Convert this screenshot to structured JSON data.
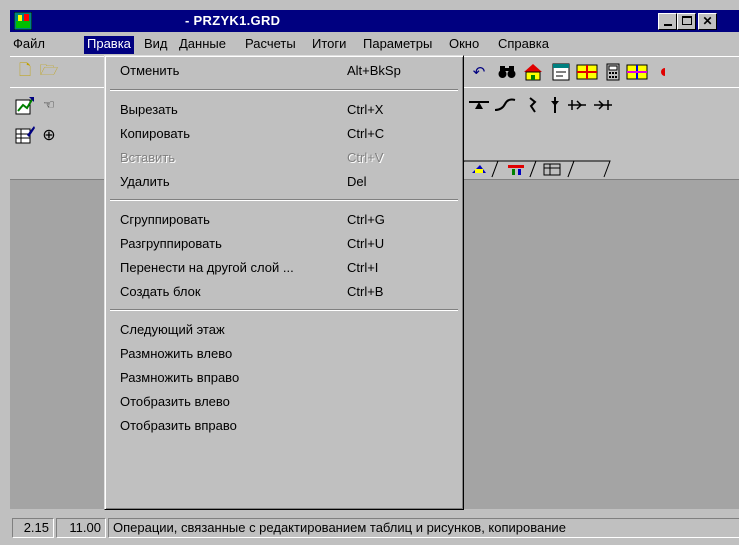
{
  "window": {
    "title": "- PRZYK1.GRD"
  },
  "menubar": {
    "items": [
      {
        "label": "Файл",
        "active": false
      },
      {
        "label": "Правка",
        "active": true
      },
      {
        "label": "Вид",
        "active": false
      },
      {
        "label": "Данные",
        "active": false
      },
      {
        "label": "Расчеты",
        "active": false
      },
      {
        "label": "Итоги",
        "active": false
      },
      {
        "label": "Параметры",
        "active": false
      },
      {
        "label": "Окно",
        "active": false
      },
      {
        "label": "Справка",
        "active": false
      }
    ]
  },
  "edit_menu": {
    "items": [
      {
        "label": "Отменить",
        "shortcut": "Alt+BkSp",
        "disabled": false
      },
      {
        "label": "Вырезать",
        "shortcut": "Ctrl+X",
        "disabled": false
      },
      {
        "label": "Копировать",
        "shortcut": "Ctrl+C",
        "disabled": false
      },
      {
        "label": "Вставить",
        "shortcut": "Ctrl+V",
        "disabled": true
      },
      {
        "label": "Удалить",
        "shortcut": "Del",
        "disabled": false
      },
      {
        "label": "Сгруппировать",
        "shortcut": "Ctrl+G",
        "disabled": false
      },
      {
        "label": "Разгруппировать",
        "shortcut": "Ctrl+U",
        "disabled": false
      },
      {
        "label": "Перенести на другой слой ...",
        "shortcut": "Ctrl+I",
        "disabled": false
      },
      {
        "label": "Создать блок",
        "shortcut": "Ctrl+B",
        "disabled": false
      },
      {
        "label": "Следующий этаж",
        "shortcut": "",
        "disabled": false
      },
      {
        "label": "Размножить влево",
        "shortcut": "",
        "disabled": false
      },
      {
        "label": "Размножить вправо",
        "shortcut": "",
        "disabled": false
      },
      {
        "label": "Отобразить влево",
        "shortcut": "",
        "disabled": false
      },
      {
        "label": "Отобразить вправо",
        "shortcut": "",
        "disabled": false
      }
    ]
  },
  "statusbar": {
    "coord_x": "2.15",
    "coord_y": "11.00",
    "message": "Операции, связанные с редактированием таблиц  и рисунков, копирование"
  },
  "colors": {
    "titlebar": "#000080",
    "face": "#c0c0c0",
    "workspace": "#a4a4a4"
  }
}
